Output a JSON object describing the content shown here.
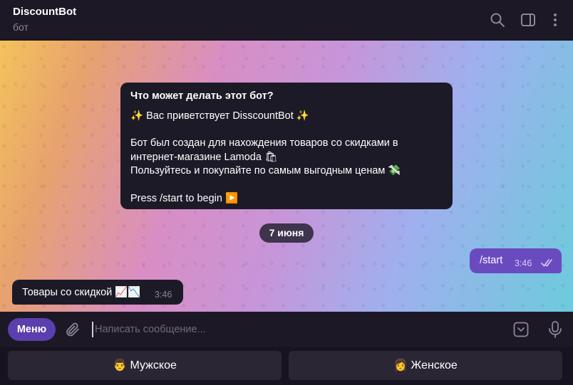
{
  "header": {
    "title": "DiscountBot",
    "subtitle": "бот",
    "icons": [
      "search-icon",
      "sidebar-toggle-icon",
      "more-vertical-icon"
    ]
  },
  "info_card": {
    "title": "Что может делать этот бот?",
    "welcome": "✨ Вас приветствует DisscountBot ✨",
    "line1": "Бот был создан для нахождения товаров со скидками в",
    "line2": "интернет-магазине Lamoda 🛍",
    "line3": "Пользуйтесь и покупайте по самым выгодным ценам 💸",
    "line4": "Press /start to begin ▶️"
  },
  "date_separator": "7 июня",
  "messages": {
    "outgoing": {
      "text": "/start",
      "time": "3:46",
      "status": "read"
    },
    "incoming": {
      "text": "Товары со скидкой 📈📉",
      "time": "3:46"
    }
  },
  "composer": {
    "menu_label": "Меню",
    "placeholder": "Написать сообщение...",
    "value": ""
  },
  "keyboard": {
    "left_label": "👨 Мужское",
    "right_label": "👩 Женское"
  },
  "colors": {
    "accent": "#5b3fae",
    "outgoing_bubble": "#6a4bbf",
    "panel": "#1c1826"
  }
}
